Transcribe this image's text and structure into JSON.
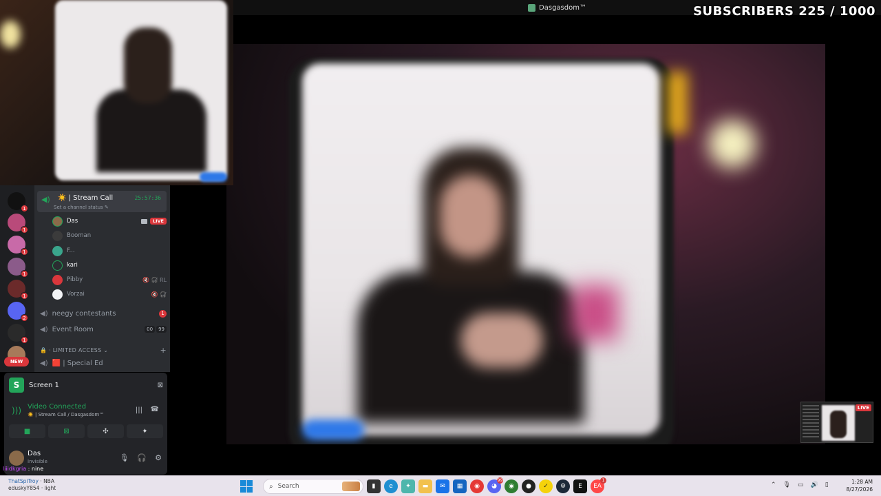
{
  "overlay": {
    "subscribers_label": "SUBSCRIBERS 225 / 1000"
  },
  "window": {
    "title": "Dasgasdom™"
  },
  "voice_channel": {
    "name": "☀️ | Stream Call",
    "timer": "25:57:36",
    "status_placeholder": "Set a channel status ✎",
    "members": [
      {
        "name": "Das",
        "live_badge": "LIVE"
      },
      {
        "name": "Booman"
      },
      {
        "name": "F..."
      },
      {
        "name": "kari"
      },
      {
        "name": "Pibby",
        "icons": "🔇 🎧̸ RL"
      },
      {
        "name": "Vorzai",
        "icons": "🔇 🎧̸"
      }
    ]
  },
  "channels": [
    {
      "name": "neegy contestants",
      "badge": "1"
    },
    {
      "name": "Event Room",
      "count_a": "00",
      "count_b": "99"
    }
  ],
  "category": {
    "label": "🔒 · LIMITED ACCESS ⌄",
    "channel": "🟥 | Special Ed"
  },
  "server_rail": {
    "new_label": "NEW",
    "badges": [
      "1",
      "1",
      "1",
      "1",
      "1",
      "1",
      "2",
      "1"
    ]
  },
  "voice_panel": {
    "screen_label": "Screen 1",
    "connected_label": "Video Connected",
    "connected_sub": "☀️ | Stream Call / Dasgasdom™",
    "user_name": "Das",
    "user_status": "Invisible"
  },
  "chat": {
    "line1_name": "liiidkgria",
    "line1_text": ": nine",
    "line2_name": "ThatSpiTroy",
    "line2_tag": "· NBA",
    "line3_text": "eduskyY854 · light"
  },
  "cam_small": {
    "live_badge": "LIVE"
  },
  "taskbar": {
    "search_placeholder": "Search",
    "time": "1:28 AM",
    "date": "8/27/2026",
    "notification_counts": [
      "99",
      "1"
    ]
  }
}
